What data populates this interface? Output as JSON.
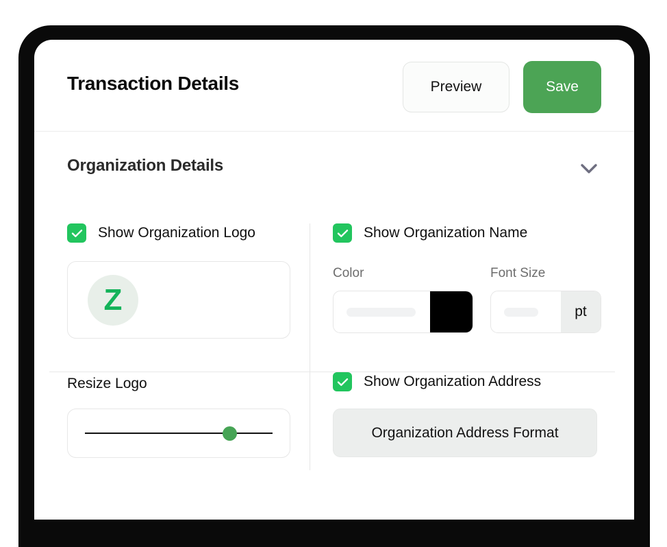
{
  "header": {
    "title": "Transaction Details",
    "preview_label": "Preview",
    "save_label": "Save",
    "save_color": "#4CA455"
  },
  "section": {
    "title": "Organization Details",
    "toggle_icon": "chevron-down-icon",
    "toggle_color": "#6e6e80"
  },
  "left_column": {
    "show_logo": {
      "label": "Show Organization Logo",
      "checked": true,
      "check_color": "#22C55E"
    },
    "logo_preview": {
      "letter": "Z",
      "letter_color": "#14B35A",
      "circle_color": "#e8efe9"
    },
    "resize_logo": {
      "label": "Resize Logo",
      "value_percent": 77,
      "thumb_color": "#46A455"
    }
  },
  "right_column": {
    "show_name": {
      "label": "Show Organization Name",
      "checked": true,
      "check_color": "#22C55E"
    },
    "color_field": {
      "label": "Color",
      "value": "",
      "swatch_color": "#000000"
    },
    "font_size_field": {
      "label": "Font Size",
      "value": "",
      "unit": "pt"
    },
    "show_address": {
      "label": "Show Organization Address",
      "checked": true,
      "check_color": "#22C55E"
    },
    "address_format_label": "Organization Address Format"
  }
}
